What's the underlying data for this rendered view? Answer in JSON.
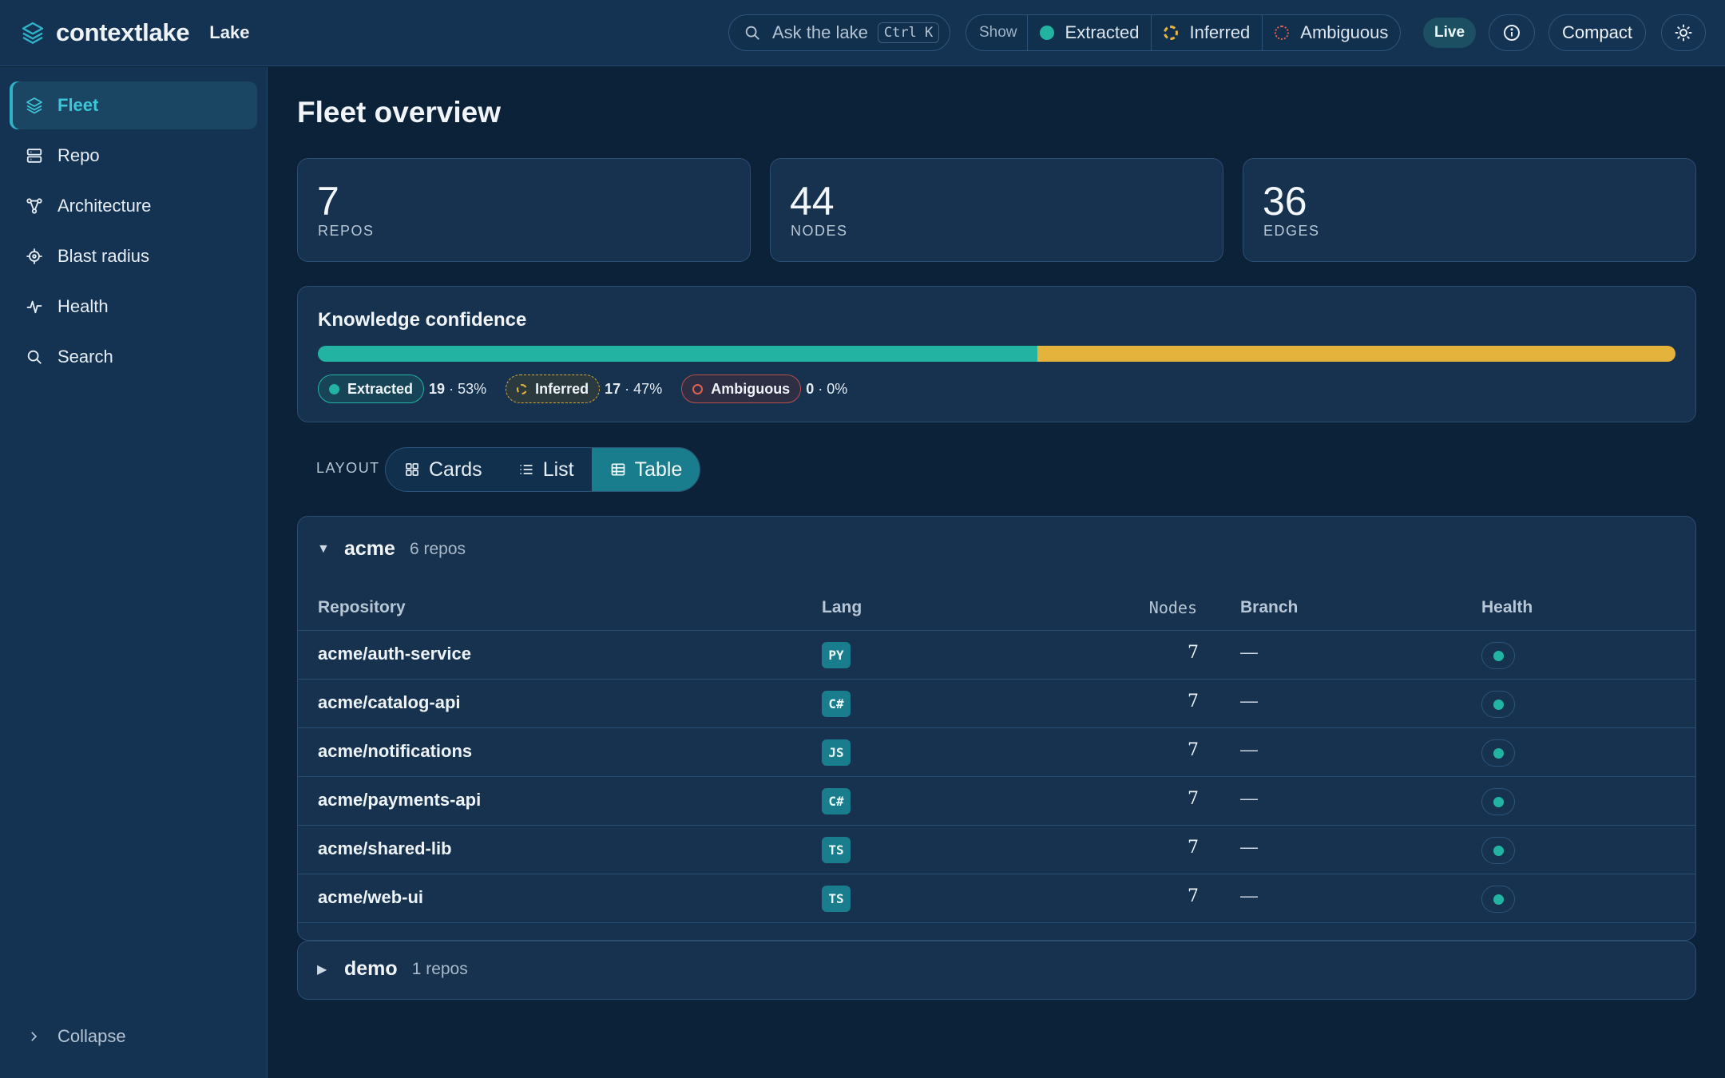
{
  "header": {
    "brand": "contextlake",
    "section": "Lake",
    "search": {
      "placeholder": "Ask the lake",
      "shortcut": "Ctrl K"
    },
    "show": {
      "label": "Show",
      "filters": [
        {
          "label": "Extracted",
          "icon": "solid-dot-icon"
        },
        {
          "label": "Inferred",
          "icon": "dashed-circle-icon"
        },
        {
          "label": "Ambiguous",
          "icon": "dotted-circle-icon"
        }
      ]
    },
    "live_label": "Live",
    "compact_label": "Compact"
  },
  "sidebar": {
    "items": [
      {
        "label": "Fleet",
        "icon": "layers-icon",
        "active": true
      },
      {
        "label": "Repo",
        "icon": "server-icon"
      },
      {
        "label": "Architecture",
        "icon": "graph-icon"
      },
      {
        "label": "Blast radius",
        "icon": "target-icon"
      },
      {
        "label": "Health",
        "icon": "pulse-icon"
      },
      {
        "label": "Search",
        "icon": "search-icon"
      }
    ],
    "collapse_label": "Collapse"
  },
  "main": {
    "title": "Fleet overview",
    "stats": [
      {
        "value": "7",
        "label": "REPOS"
      },
      {
        "value": "44",
        "label": "NODES"
      },
      {
        "value": "36",
        "label": "EDGES"
      }
    ],
    "confidence": {
      "title": "Knowledge confidence",
      "segments": [
        {
          "label": "Extracted",
          "count": "19",
          "pct_text": "53%",
          "fraction": 0.53,
          "color": "#23b3a3"
        },
        {
          "label": "Inferred",
          "count": "17",
          "pct_text": "47%",
          "fraction": 0.47,
          "color": "#e4b33b"
        },
        {
          "label": "Ambiguous",
          "count": "0",
          "pct_text": "0%",
          "fraction": 0,
          "color": "#e0614f"
        }
      ]
    },
    "layout": {
      "label": "LAYOUT",
      "options": [
        "Cards",
        "List",
        "Table"
      ],
      "selected": "Table"
    },
    "groups": [
      {
        "name": "acme",
        "count": "6 repos",
        "expanded": true,
        "columns": [
          "Repository",
          "Lang",
          "Nodes",
          "Branch",
          "Health"
        ],
        "rows": [
          {
            "repo": "acme/auth-service",
            "lang": "PY",
            "nodes": "7",
            "branch": "—"
          },
          {
            "repo": "acme/catalog-api",
            "lang": "C#",
            "nodes": "7",
            "branch": "—"
          },
          {
            "repo": "acme/notifications",
            "lang": "JS",
            "nodes": "7",
            "branch": "—"
          },
          {
            "repo": "acme/payments-api",
            "lang": "C#",
            "nodes": "7",
            "branch": "—"
          },
          {
            "repo": "acme/shared-lib",
            "lang": "TS",
            "nodes": "7",
            "branch": "—"
          },
          {
            "repo": "acme/web-ui",
            "lang": "TS",
            "nodes": "7",
            "branch": "—"
          }
        ]
      },
      {
        "name": "demo",
        "count": "1 repos",
        "expanded": false
      }
    ]
  }
}
